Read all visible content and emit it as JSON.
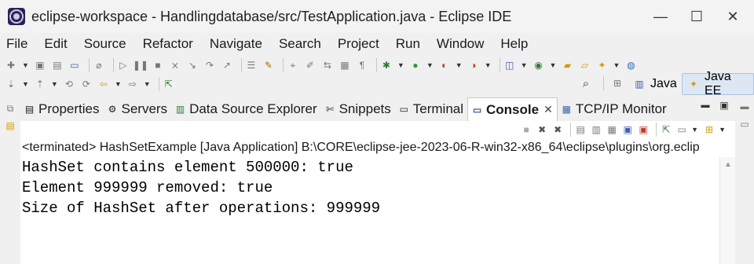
{
  "window": {
    "title": "eclipse-workspace - Handlingdatabase/src/TestApplication.java - Eclipse IDE",
    "minimize": "—",
    "maximize": "☐",
    "close": "✕"
  },
  "menu": [
    "File",
    "Edit",
    "Source",
    "Refactor",
    "Navigate",
    "Search",
    "Project",
    "Run",
    "Window",
    "Help"
  ],
  "perspectives": {
    "java": "Java",
    "javaee": "Java EE"
  },
  "tabs": [
    {
      "label": "Properties",
      "icon": "properties-icon"
    },
    {
      "label": "Servers",
      "icon": "servers-icon"
    },
    {
      "label": "Data Source Explorer",
      "icon": "data-source-icon"
    },
    {
      "label": "Snippets",
      "icon": "snippets-icon"
    },
    {
      "label": "Terminal",
      "icon": "terminal-icon"
    },
    {
      "label": "Console",
      "icon": "console-icon",
      "active": true
    },
    {
      "label": "TCP/IP Monitor",
      "icon": "tcpip-icon"
    }
  ],
  "console": {
    "status": "<terminated> HashSetExample [Java Application] B:\\CORE\\eclipse-jee-2023-06-R-win32-x86_64\\eclipse\\plugins\\org.eclip",
    "lines": [
      "HashSet contains element 500000: true",
      "Element 999999 removed: true",
      "Size of HashSet after operations: 999999"
    ]
  },
  "colors": {
    "accent": "#2c2255",
    "active_perspective": "#dde7f3"
  }
}
